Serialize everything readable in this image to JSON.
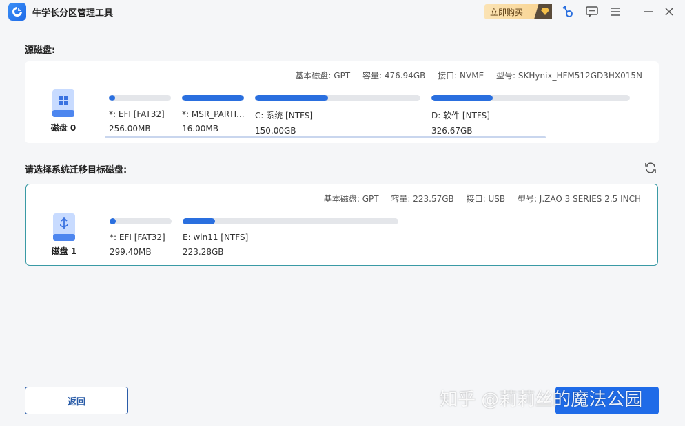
{
  "app": {
    "title": "牛学长分区管理工具",
    "buy_label": "立即购买",
    "accent": "#2a6fdf"
  },
  "source": {
    "label": "源磁盘:",
    "disk_name": "磁盘 0",
    "meta": {
      "type": "基本磁盘: GPT",
      "capacity": "容量: 476.94GB",
      "interface": "接口: NVME",
      "model": "型号: SKHynix_HFM512GD3HX015N"
    },
    "partitions": [
      {
        "name": "*: EFI [FAT32]",
        "size": "256.00MB",
        "used": 0.1
      },
      {
        "name": "*: MSR_PARTI...",
        "size": "16.00MB",
        "used": 1.0
      },
      {
        "name": "C: 系统 [NTFS]",
        "size": "150.00GB",
        "used": 0.44
      },
      {
        "name": "D: 软件 [NTFS]",
        "size": "326.67GB",
        "used": 0.31
      }
    ]
  },
  "target": {
    "label": "请选择系统迁移目标磁盘:",
    "disk_name": "磁盘 1",
    "meta": {
      "type": "基本磁盘: GPT",
      "capacity": "容量: 223.57GB",
      "interface": "接口: USB",
      "model": "型号: J.ZAO 3 SERIES 2.5 INCH"
    },
    "partitions": [
      {
        "name": "*: EFI [FAT32]",
        "size": "299.40MB",
        "used": 0.1
      },
      {
        "name": "E: win11 [NTFS]",
        "size": "223.28GB",
        "used": 0.15
      }
    ]
  },
  "footer": {
    "back_label": "返回",
    "next_label": "",
    "watermark": "知乎 @莉莉丝的魔法公园"
  }
}
